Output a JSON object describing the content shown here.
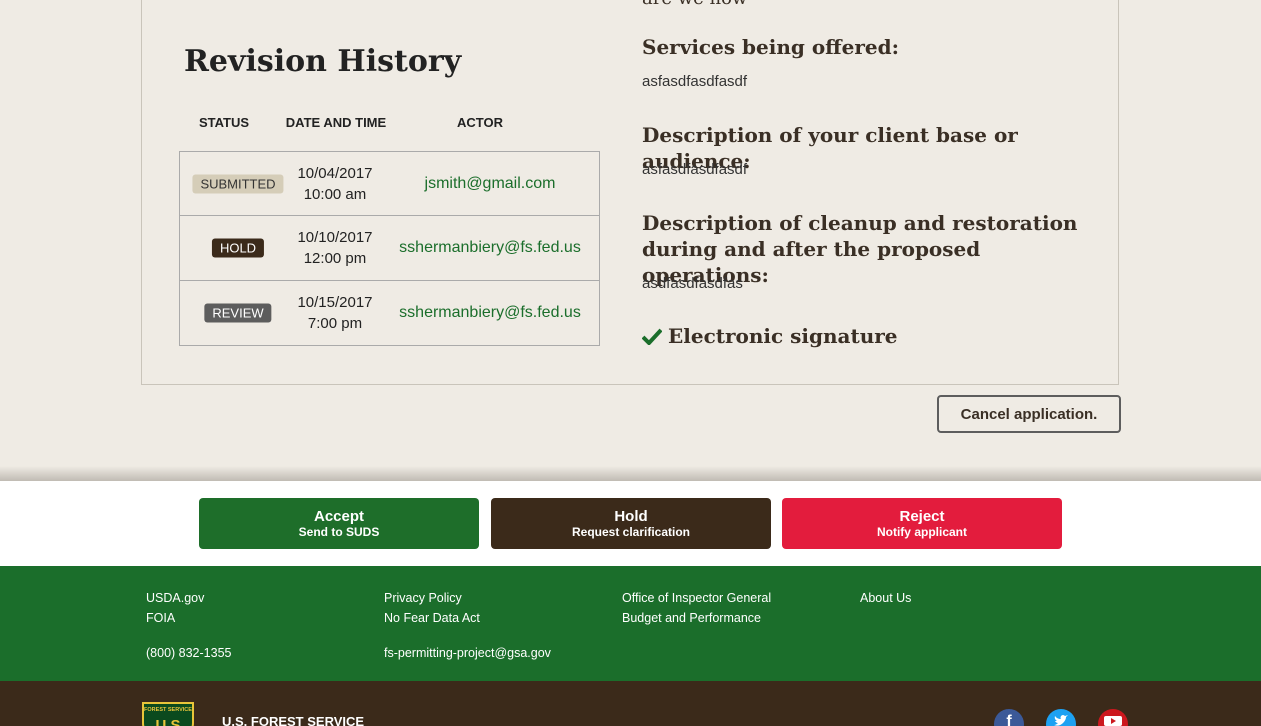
{
  "top_cut_text": "are we now",
  "revision_history": {
    "title": "Revision History",
    "headers": {
      "status": "STATUS",
      "date_time": "DATE AND TIME",
      "actor": "ACTOR"
    },
    "rows": [
      {
        "status": "SUBMITTED",
        "date": "10/04/2017",
        "time": "10:00 am",
        "actor": "jsmith@gmail.com"
      },
      {
        "status": "HOLD",
        "date": "10/10/2017",
        "time": "12:00 pm",
        "actor": "sshermanbiery@fs.fed.us"
      },
      {
        "status": "REVIEW",
        "date": "10/15/2017",
        "time": "7:00 pm",
        "actor": "sshermanbiery@fs.fed.us"
      }
    ]
  },
  "details": {
    "services_label": "Services being offered:",
    "services_value": "asfasdfasdfasdf",
    "client_label": "Description of your client base or audience:",
    "client_value": "asfasdfasdfasdf",
    "cleanup_label": "Description of cleanup and restoration during and after the proposed operations:",
    "cleanup_value": "asdfasdfasdfas",
    "signature_label": "Electronic signature"
  },
  "cancel_label": "Cancel application.",
  "actions": {
    "accept": {
      "label": "Accept",
      "sub": "Send to SUDS"
    },
    "hold": {
      "label": "Hold",
      "sub": "Request clarification"
    },
    "reject": {
      "label": "Reject",
      "sub": "Notify applicant"
    }
  },
  "footer": {
    "usda": "USDA.gov",
    "foia": "FOIA",
    "phone": "(800) 832-1355",
    "privacy": "Privacy Policy",
    "nofear": "No Fear Data Act",
    "email": "fs-permitting-project@gsa.gov",
    "oig": "Office of Inspector General",
    "budget": "Budget and Performance",
    "about": "About Us",
    "agency_name": "U.S. FOREST SERVICE",
    "logo_text": "FOREST SERVICE",
    "logo_initials": "U S",
    "social": [
      "facebook-icon",
      "twitter-icon",
      "youtube-icon"
    ]
  },
  "colors": {
    "green": "#1b6e2b",
    "brown": "#3b2a1a",
    "red": "#e31c3d",
    "background": "#efebe4"
  }
}
